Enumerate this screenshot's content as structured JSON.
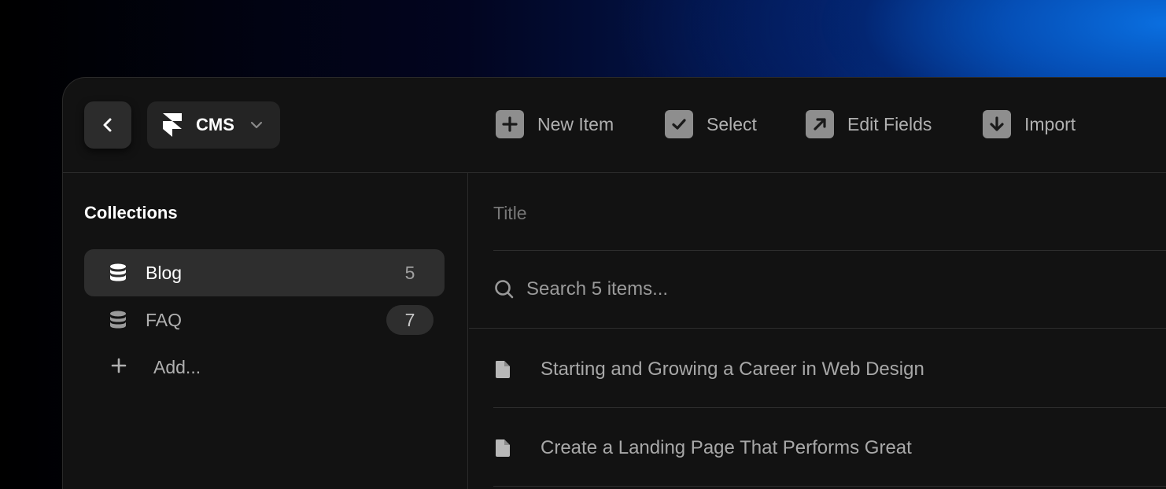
{
  "header": {
    "app_name": "CMS",
    "icons": {
      "back": "chevron-left-icon",
      "logo": "framer-logo-icon",
      "switch": "chevron-down-icon"
    },
    "actions": [
      {
        "label": "New Item",
        "icon": "plus-square-icon"
      },
      {
        "label": "Select",
        "icon": "check-square-icon"
      },
      {
        "label": "Edit Fields",
        "icon": "arrow-up-right-square-icon"
      },
      {
        "label": "Import",
        "icon": "arrow-down-square-icon"
      }
    ]
  },
  "sidebar": {
    "heading": "Collections",
    "items": [
      {
        "label": "Blog",
        "count": "5",
        "icon": "database-icon",
        "active": true
      },
      {
        "label": "FAQ",
        "count": "7",
        "icon": "database-icon",
        "active": false
      }
    ],
    "add_label": "Add..."
  },
  "main": {
    "column_title": "Title",
    "search_placeholder": "Search 5 items...",
    "rows": [
      {
        "title": "Starting and Growing a Career in Web Design",
        "icon": "document-icon"
      },
      {
        "title": "Create a Landing Page That Performs Great",
        "icon": "document-icon"
      }
    ]
  },
  "colors": {
    "window_bg": "#121212",
    "accent_blue": "#0a6fe0",
    "muted_text": "#b0b0b0"
  }
}
